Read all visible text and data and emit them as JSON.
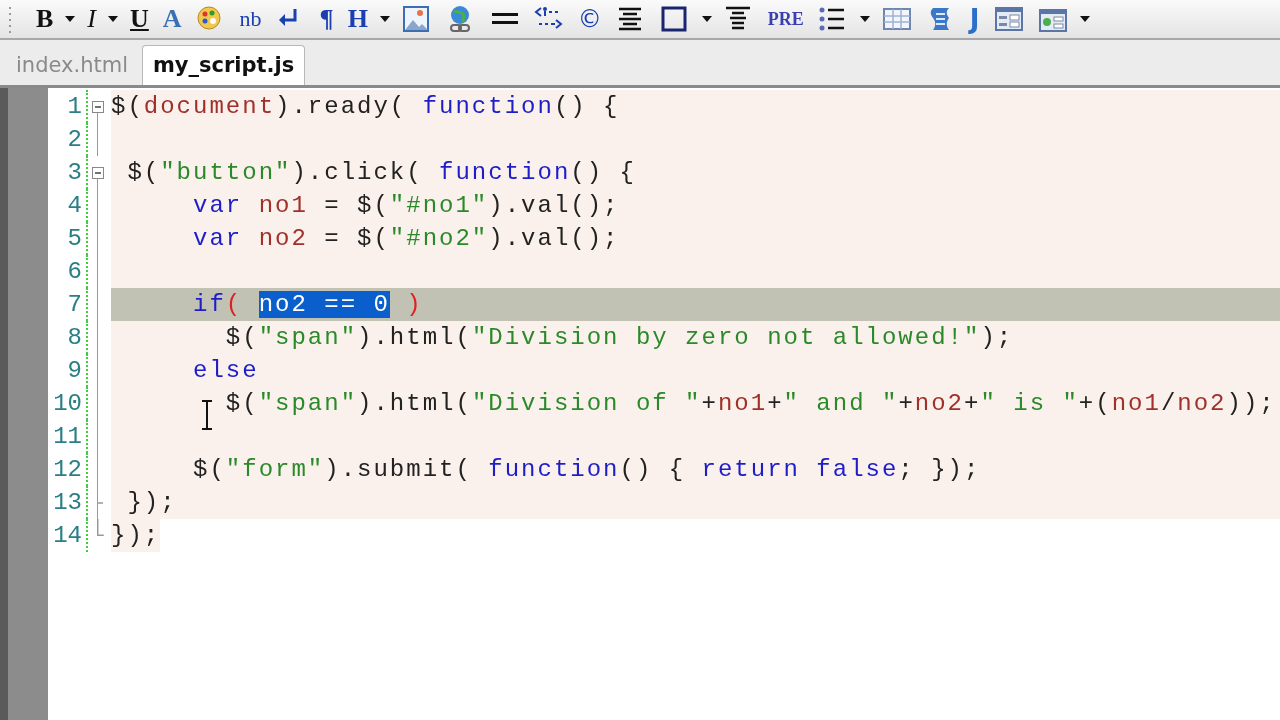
{
  "toolbar": [
    {
      "kind": "bold",
      "label": "B",
      "dropdown": true
    },
    {
      "kind": "italic",
      "label": "I",
      "dropdown": true
    },
    {
      "kind": "underline",
      "label": "U",
      "dropdown": false
    },
    {
      "kind": "font",
      "label": "A",
      "dropdown": false
    },
    {
      "kind": "palette",
      "dropdown": false
    },
    {
      "kind": "nbsp",
      "label": "nb",
      "dropdown": false
    },
    {
      "kind": "linebreak",
      "dropdown": false
    },
    {
      "kind": "paragraph",
      "label": "¶",
      "dropdown": false
    },
    {
      "kind": "heading",
      "label": "H",
      "dropdown": true
    },
    {
      "kind": "image",
      "dropdown": false
    },
    {
      "kind": "link",
      "dropdown": false
    },
    {
      "kind": "rule",
      "dropdown": false
    },
    {
      "kind": "comment",
      "dropdown": false
    },
    {
      "kind": "copyright",
      "label": "©",
      "dropdown": false
    },
    {
      "kind": "center",
      "dropdown": false
    },
    {
      "kind": "box",
      "dropdown": true
    },
    {
      "kind": "valign",
      "dropdown": false
    },
    {
      "kind": "pre",
      "label": "PRE",
      "dropdown": false
    },
    {
      "kind": "list",
      "dropdown": true
    },
    {
      "kind": "table",
      "dropdown": false
    },
    {
      "kind": "script",
      "dropdown": false
    },
    {
      "kind": "javascript",
      "label": "J",
      "dropdown": false
    },
    {
      "kind": "form",
      "dropdown": false
    },
    {
      "kind": "input",
      "dropdown": true
    }
  ],
  "tabs": [
    {
      "label": "index.html",
      "selected": false
    },
    {
      "label": "my_script.js",
      "selected": true
    }
  ],
  "editor": {
    "lines": [
      {
        "number": "1",
        "kind": "fold_start",
        "in_block": true,
        "current": false,
        "tokens": [
          {
            "kind": "plain",
            "text": "$("
          },
          {
            "kind": "variable",
            "text": "document"
          },
          {
            "kind": "plain",
            "text": ").ready( "
          },
          {
            "kind": "keyword",
            "text": "function"
          },
          {
            "kind": "plain",
            "text": "() {"
          }
        ]
      },
      {
        "number": "2",
        "kind": "body",
        "in_block": true,
        "current": false
      },
      {
        "number": "3",
        "kind": "fold_start",
        "in_block": true,
        "current": false,
        "tokens": [
          {
            "kind": "plain",
            "text": " $("
          },
          {
            "kind": "string",
            "text": "\"button\""
          },
          {
            "kind": "plain",
            "text": ").click( "
          },
          {
            "kind": "keyword",
            "text": "function"
          },
          {
            "kind": "plain",
            "text": "() {"
          }
        ]
      },
      {
        "number": "4",
        "kind": "body",
        "in_block": true,
        "current": false,
        "tokens": [
          {
            "kind": "keyword",
            "text": "     var"
          },
          {
            "kind": "variable",
            "text": " no1"
          },
          {
            "kind": "plain",
            "text": " = $("
          },
          {
            "kind": "string",
            "text": "\"#no1\""
          },
          {
            "kind": "plain",
            "text": ").val();"
          }
        ]
      },
      {
        "number": "5",
        "kind": "body",
        "in_block": true,
        "current": false,
        "tokens": [
          {
            "kind": "keyword",
            "text": "     var"
          },
          {
            "kind": "variable",
            "text": " no2"
          },
          {
            "kind": "plain",
            "text": " = $("
          },
          {
            "kind": "string",
            "text": "\"#no2\""
          },
          {
            "kind": "plain",
            "text": ").val();"
          }
        ]
      },
      {
        "number": "6",
        "kind": "body",
        "in_block": true,
        "current": false
      },
      {
        "number": "7",
        "kind": "body",
        "in_block": true,
        "current": true,
        "tokens": [
          {
            "kind": "keyword",
            "text": "     if"
          },
          {
            "kind": "paren",
            "text": "( "
          },
          {
            "kind": "selected",
            "text": "no2 == 0"
          },
          {
            "kind": "paren",
            "text": " )"
          }
        ]
      },
      {
        "number": "8",
        "kind": "body",
        "in_block": true,
        "current": false,
        "tokens": [
          {
            "kind": "plain",
            "text": "       $("
          },
          {
            "kind": "string",
            "text": "\"span\""
          },
          {
            "kind": "plain",
            "text": ").html("
          },
          {
            "kind": "string",
            "text": "\"Division by zero not allowed!\""
          },
          {
            "kind": "plain",
            "text": ");"
          }
        ]
      },
      {
        "number": "9",
        "kind": "body",
        "in_block": true,
        "current": false,
        "tokens": [
          {
            "kind": "keyword",
            "text": "     else"
          }
        ]
      },
      {
        "number": "10",
        "kind": "body",
        "in_block": true,
        "current": false,
        "tokens": [
          {
            "kind": "plain",
            "text": "       $("
          },
          {
            "kind": "string",
            "text": "\"span\""
          },
          {
            "kind": "plain",
            "text": ").html("
          },
          {
            "kind": "string",
            "text": "\"Division of \""
          },
          {
            "kind": "plain",
            "text": "+"
          },
          {
            "kind": "variable",
            "text": "no1"
          },
          {
            "kind": "plain",
            "text": "+"
          },
          {
            "kind": "string",
            "text": "\" and \""
          },
          {
            "kind": "plain",
            "text": "+"
          },
          {
            "kind": "variable",
            "text": "no2"
          },
          {
            "kind": "plain",
            "text": "+"
          },
          {
            "kind": "string",
            "text": "\" is \""
          },
          {
            "kind": "plain",
            "text": "+("
          },
          {
            "kind": "variable",
            "text": "no1"
          },
          {
            "kind": "plain",
            "text": "/"
          },
          {
            "kind": "variable",
            "text": "no2"
          },
          {
            "kind": "plain",
            "text": "));"
          }
        ]
      },
      {
        "number": "11",
        "kind": "body",
        "in_block": true,
        "current": false
      },
      {
        "number": "12",
        "kind": "body",
        "in_block": true,
        "current": false,
        "tokens": [
          {
            "kind": "plain",
            "text": "     $("
          },
          {
            "kind": "string",
            "text": "\"form\""
          },
          {
            "kind": "plain",
            "text": ").submit( "
          },
          {
            "kind": "keyword",
            "text": "function"
          },
          {
            "kind": "plain",
            "text": "() { "
          },
          {
            "kind": "keyword",
            "text": "return false"
          },
          {
            "kind": "plain",
            "text": "; });"
          }
        ]
      },
      {
        "number": "13",
        "kind": "inner_end",
        "in_block": true,
        "current": false,
        "tokens": [
          {
            "kind": "plain",
            "text": " });"
          }
        ]
      },
      {
        "number": "14",
        "kind": "fold_end",
        "in_block": false,
        "current": false,
        "tokens": [
          {
            "kind": "plain",
            "text": "});"
          }
        ]
      }
    ]
  }
}
